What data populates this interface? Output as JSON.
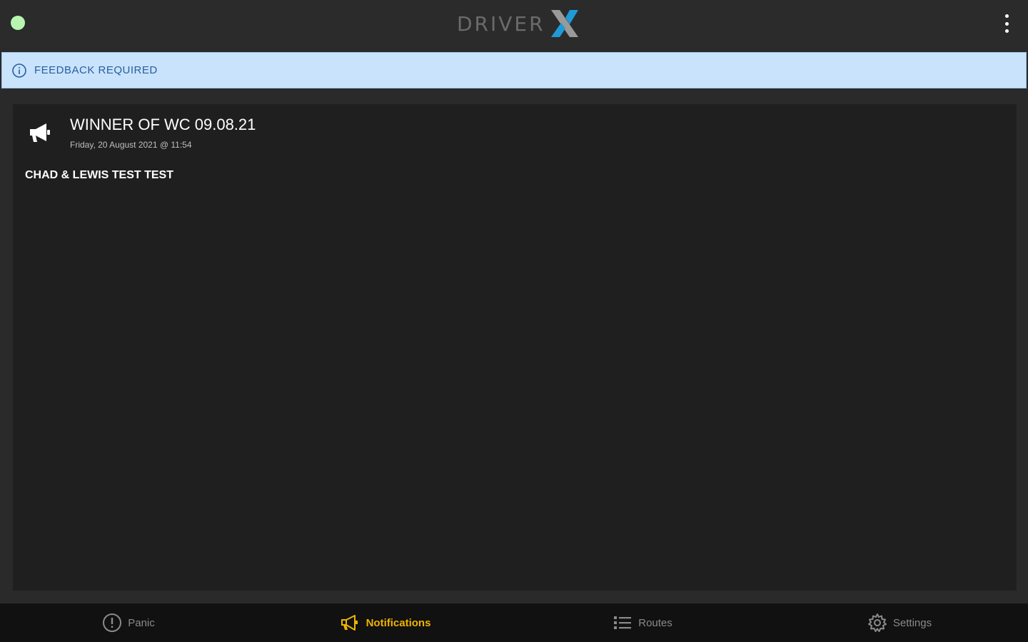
{
  "header": {
    "logo_text": "DRIVER",
    "status_color": "#b7f5b0"
  },
  "banner": {
    "text": "FEEDBACK REQUIRED",
    "icon": "info-icon"
  },
  "notification": {
    "icon": "megaphone-icon",
    "title": "WINNER OF WC 09.08.21",
    "date": "Friday, 20 August 2021 @ 11:54",
    "body": "CHAD & LEWIS TEST TEST"
  },
  "nav": {
    "items": [
      {
        "label": "Panic",
        "icon": "alert-circle-icon",
        "active": false
      },
      {
        "label": "Notifications",
        "icon": "megaphone-icon",
        "active": true
      },
      {
        "label": "Routes",
        "icon": "list-icon",
        "active": false
      },
      {
        "label": "Settings",
        "icon": "gear-icon",
        "active": false
      }
    ],
    "active_color": "#f0b400"
  }
}
